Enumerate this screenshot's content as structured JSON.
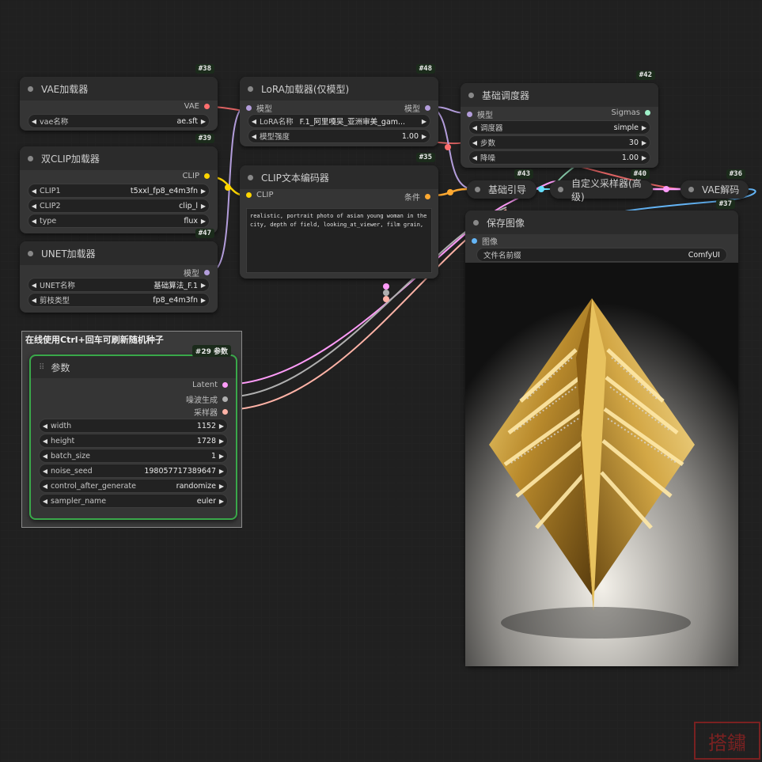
{
  "nodes": {
    "vae_loader": {
      "id": "#38",
      "title": "VAE加载器",
      "out": "VAE",
      "widgets": [
        {
          "label": "vae名称",
          "value": "ae.sft"
        }
      ]
    },
    "dual_clip": {
      "id": "#39",
      "title": "双CLIP加载器",
      "out": "CLIP",
      "widgets": [
        {
          "label": "CLIP1",
          "value": "t5xxl_fp8_e4m3fn"
        },
        {
          "label": "CLIP2",
          "value": "clip_l"
        },
        {
          "label": "type",
          "value": "flux"
        }
      ]
    },
    "unet": {
      "id": "#47",
      "title": "UNET加载器",
      "out": "模型",
      "widgets": [
        {
          "label": "UNET名称",
          "value": "基础算法_F.1"
        },
        {
          "label": "剪枝类型",
          "value": "fp8_e4m3fn"
        }
      ]
    },
    "lora": {
      "id": "#48",
      "title": "LoRA加载器(仅模型)",
      "in": "模型",
      "out": "模型",
      "widgets": [
        {
          "label": "LoRA名称",
          "value": "F.1_阿里嘎吴_亚洲审美_gam..."
        },
        {
          "label": "模型强度",
          "value": "1.00"
        }
      ]
    },
    "clip_text": {
      "id": "#35",
      "title": "CLIP文本编码器",
      "in": "CLIP",
      "out": "条件",
      "text": "realistic, portrait photo of asian young woman in the city, depth of field, looking_at_viewer, film grain,"
    },
    "scheduler": {
      "id": "#42",
      "title": "基础调度器",
      "in": "模型",
      "out": "Sigmas",
      "widgets": [
        {
          "label": "调度器",
          "value": "simple"
        },
        {
          "label": "步数",
          "value": "30"
        },
        {
          "label": "降噪",
          "value": "1.00"
        }
      ]
    },
    "guider": {
      "id": "#43",
      "title": "基础引导"
    },
    "sampler": {
      "id": "#40",
      "title": "自定义采样器(高级)"
    },
    "vae_decode": {
      "id": "#36",
      "title": "VAE解码"
    },
    "save_image": {
      "id": "#37",
      "title": "保存图像",
      "in": "图像",
      "widgets": [
        {
          "label": "文件名前缀",
          "value": "ComfyUI"
        }
      ]
    },
    "params": {
      "id": "#29 参数",
      "title": "参数",
      "outs": [
        "Latent",
        "噪波生成",
        "采样器"
      ],
      "widgets": [
        {
          "label": "width",
          "value": "1152"
        },
        {
          "label": "height",
          "value": "1728"
        },
        {
          "label": "batch_size",
          "value": "1"
        },
        {
          "label": "noise_seed",
          "value": "198057717389647"
        },
        {
          "label": "control_after_generate",
          "value": "randomize"
        },
        {
          "label": "sampler_name",
          "value": "euler"
        }
      ]
    }
  },
  "group": {
    "title": "在线使用Ctrl+回车可刷新随机种子"
  },
  "colors": {
    "vae": "#ff6e6e",
    "clip": "#ffd500",
    "model": "#b39ddb",
    "cond": "#ffa931",
    "latent": "#ff9cf9",
    "image": "#64b5f6",
    "noise": "#b0b0b0",
    "sampler": "#ffb3a7"
  },
  "watermark": "搭鏽"
}
